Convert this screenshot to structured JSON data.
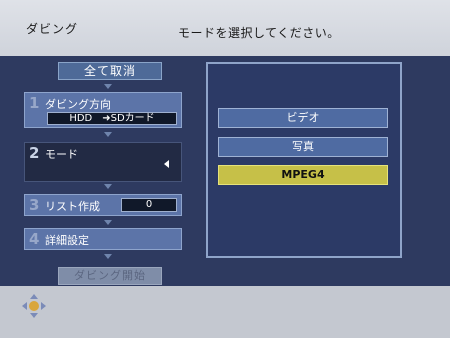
{
  "header": {
    "title": "ダビング",
    "message": "モードを選択してください。"
  },
  "left": {
    "clear_all_label": "全て取消",
    "steps": [
      {
        "num": "1",
        "label": "ダビング方向",
        "value": "HDD　➜SDカード"
      },
      {
        "num": "2",
        "label": "モード",
        "value": ""
      },
      {
        "num": "3",
        "label": "リスト作成",
        "value": "0"
      },
      {
        "num": "4",
        "label": "詳細設定"
      }
    ],
    "start_label": "ダビング開始"
  },
  "right": {
    "options": [
      {
        "label": "ビデオ",
        "selected": false
      },
      {
        "label": "写真",
        "selected": false
      },
      {
        "label": "MPEG4",
        "selected": true
      }
    ]
  },
  "colors": {
    "panel_bg": "#2e3a60",
    "selected": "#c6c048",
    "option": "#4f6ba2"
  },
  "icons": {
    "footer": "dpad-icon",
    "mode_indicator": "triangle-left-icon"
  }
}
